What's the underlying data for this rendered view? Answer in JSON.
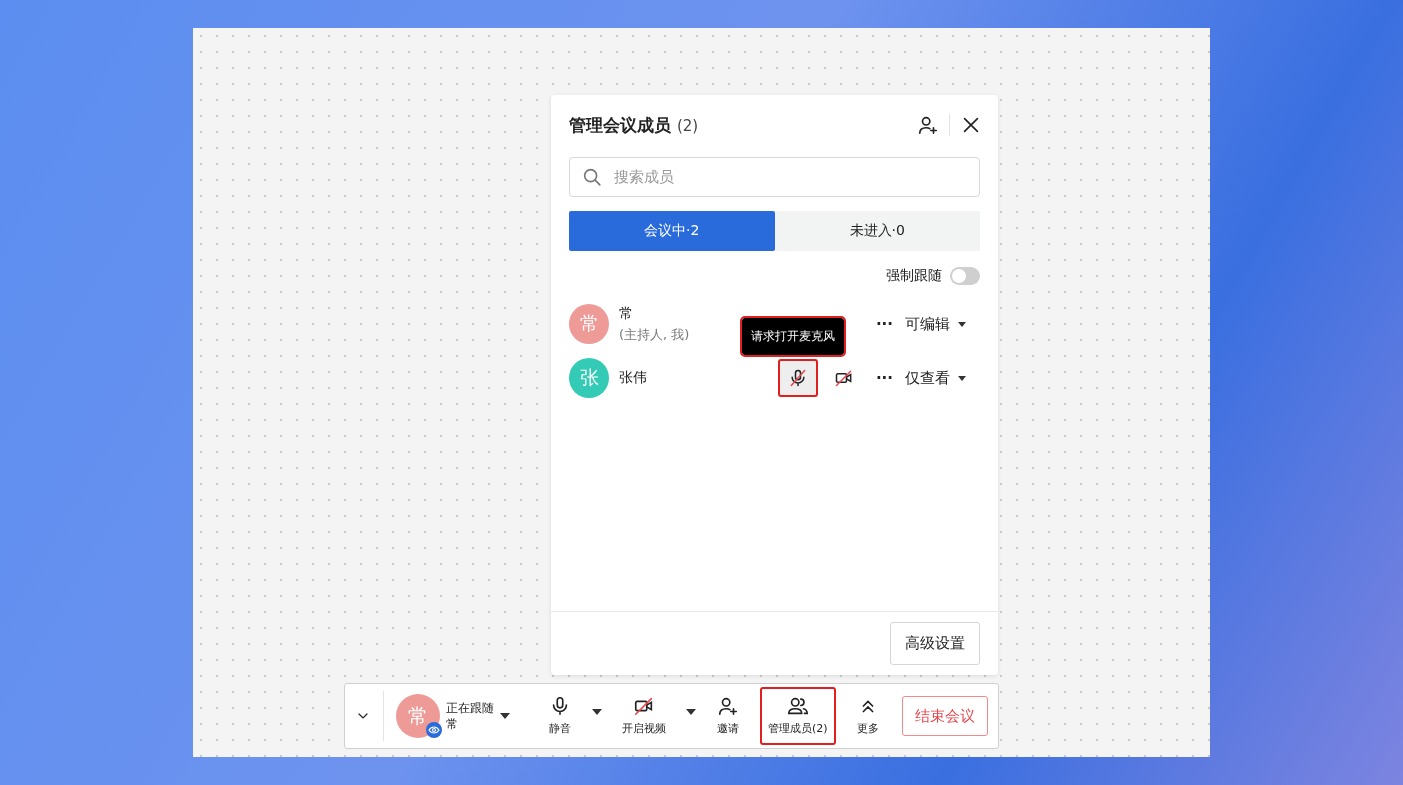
{
  "panel": {
    "title": "管理会议成员",
    "count": "(2)",
    "search": {
      "placeholder": "搜索成员"
    },
    "tabs": [
      {
        "label": "会议中·2",
        "selected": true
      },
      {
        "label": "未进入·0",
        "selected": false
      }
    ],
    "force_follow": {
      "label": "强制跟随",
      "on": false
    },
    "members": [
      {
        "avatar": "常",
        "color": "#ee9a96",
        "name": "常",
        "subtitle": "(主持人, 我)",
        "more": "···",
        "permission": "可编辑"
      },
      {
        "avatar": "张",
        "color": "#33cbb5",
        "name": "张伟",
        "more": "···",
        "permission": "仅查看",
        "media": [
          {
            "kind": "mic",
            "muted": true,
            "highlighted": true
          },
          {
            "kind": "camera",
            "muted": true,
            "highlighted": false
          }
        ]
      }
    ],
    "tooltip": {
      "text": "请求打开麦克风",
      "highlighted": true
    },
    "advanced_button": "高级设置"
  },
  "toolbar": {
    "follow": {
      "avatar": "常",
      "line1": "正在跟随",
      "line2": "常"
    },
    "items": [
      {
        "kind": "mic",
        "label": "静音",
        "caret": true,
        "highlighted": false
      },
      {
        "kind": "camera",
        "label": "开启视频",
        "caret": true,
        "highlighted": false
      },
      {
        "kind": "invite",
        "label": "邀请",
        "caret": false,
        "highlighted": false
      },
      {
        "kind": "members",
        "label": "管理成员(2)",
        "caret": false,
        "highlighted": true
      },
      {
        "kind": "more",
        "label": "更多",
        "caret": false,
        "highlighted": false
      }
    ],
    "end_button": "结束会议"
  }
}
